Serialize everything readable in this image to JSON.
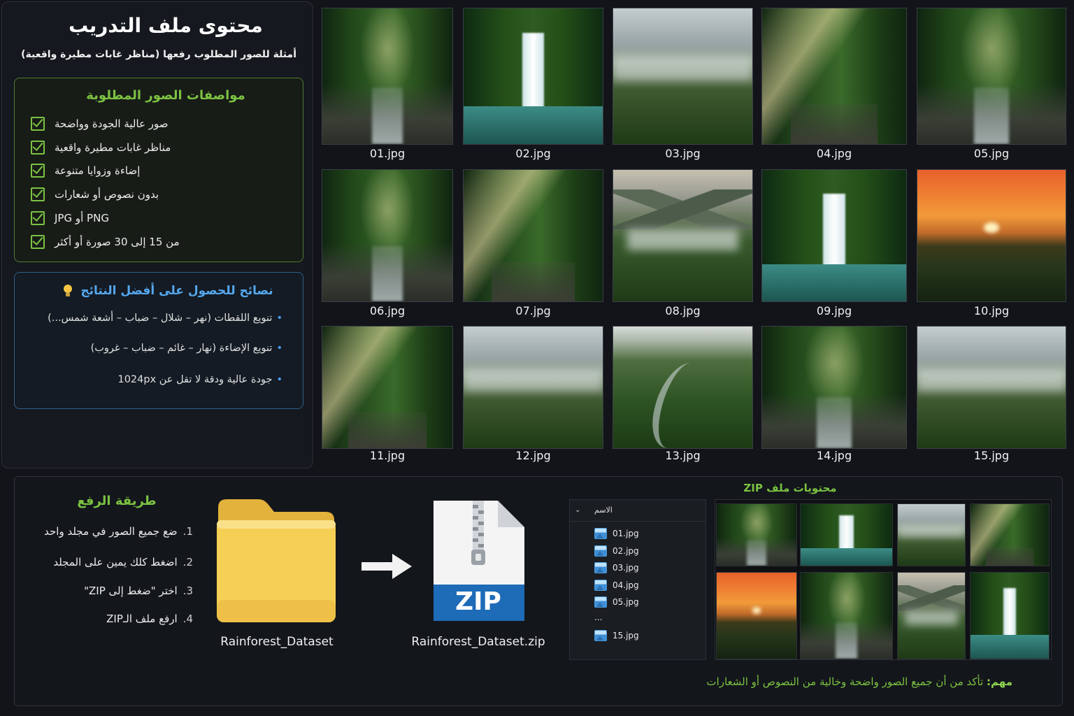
{
  "info": {
    "title": "محتوى ملف التدريب",
    "subtitle": "أمثلة للصور المطلوب رفعها (مناظر غابات مطيرة واقعية)",
    "spec_title": "مواصفات الصور المطلوبة",
    "specs": [
      "صور عالية الجودة وواضحة",
      "مناظر غابات مطيرة واقعية",
      "إضاءة وزوايا متنوعة",
      "بدون نصوص أو شعارات",
      "PNG أو JPG",
      "من 15 إلى 30 صورة أو أكثر"
    ],
    "tips_title": "نصائح للحصول على أفضل النتائج",
    "tips": [
      "تنويع اللقطات (نهر – شلال – ضباب – أشعة شمس...)",
      "تنويع الإضاءة (نهار – غائم – ضباب – غروب)",
      "جودة عالية ودقة لا تقل عن 1024px"
    ]
  },
  "gallery": [
    {
      "file": "01.jpg",
      "scene": "forest"
    },
    {
      "file": "02.jpg",
      "scene": "waterfall"
    },
    {
      "file": "03.jpg",
      "scene": "mist"
    },
    {
      "file": "04.jpg",
      "scene": "sunrays"
    },
    {
      "file": "05.jpg",
      "scene": "forest"
    },
    {
      "file": "06.jpg",
      "scene": "forest"
    },
    {
      "file": "07.jpg",
      "scene": "sunrays"
    },
    {
      "file": "08.jpg",
      "scene": "mountains"
    },
    {
      "file": "09.jpg",
      "scene": "waterfall"
    },
    {
      "file": "10.jpg",
      "scene": "sunset"
    },
    {
      "file": "11.jpg",
      "scene": "sunrays"
    },
    {
      "file": "12.jpg",
      "scene": "mist"
    },
    {
      "file": "13.jpg",
      "scene": "river"
    },
    {
      "file": "14.jpg",
      "scene": "forest"
    },
    {
      "file": "15.jpg",
      "scene": "mist"
    }
  ],
  "upload": {
    "title": "طريقة الرفع",
    "steps": [
      {
        "num": "1.",
        "text": "ضع جميع الصور في مجلد واحد"
      },
      {
        "num": "2.",
        "text": "اضغط كلك يمين على المجلد"
      },
      {
        "num": "3.",
        "text": "اختر \"ضغط إلى ZIP\""
      },
      {
        "num": "4.",
        "text": "ارفع ملف الـZIP"
      }
    ],
    "folder_label": "Rainforest_Dataset",
    "zip_label": "Rainforest_Dataset.zip",
    "zip_badge": "ZIP"
  },
  "zip_contents": {
    "title": "محتويات ملف ZIP",
    "column_name": "الاسم",
    "files": [
      "01.jpg",
      "02.jpg",
      "03.jpg",
      "04.jpg",
      "05.jpg"
    ],
    "ellipsis": "...",
    "last_file": "15.jpg",
    "mosaic": [
      "forest",
      "waterfall",
      "mist",
      "sunrays",
      "sunset",
      "forest",
      "mountains",
      "waterfall"
    ]
  },
  "note": {
    "label": "مهم:",
    "text": "تأكد من أن جميع الصور واضحة وخالية من النصوص أو الشعارات"
  },
  "colors": {
    "accent_green": "#7cc242",
    "accent_blue": "#55a8ee",
    "background": "#121419"
  }
}
